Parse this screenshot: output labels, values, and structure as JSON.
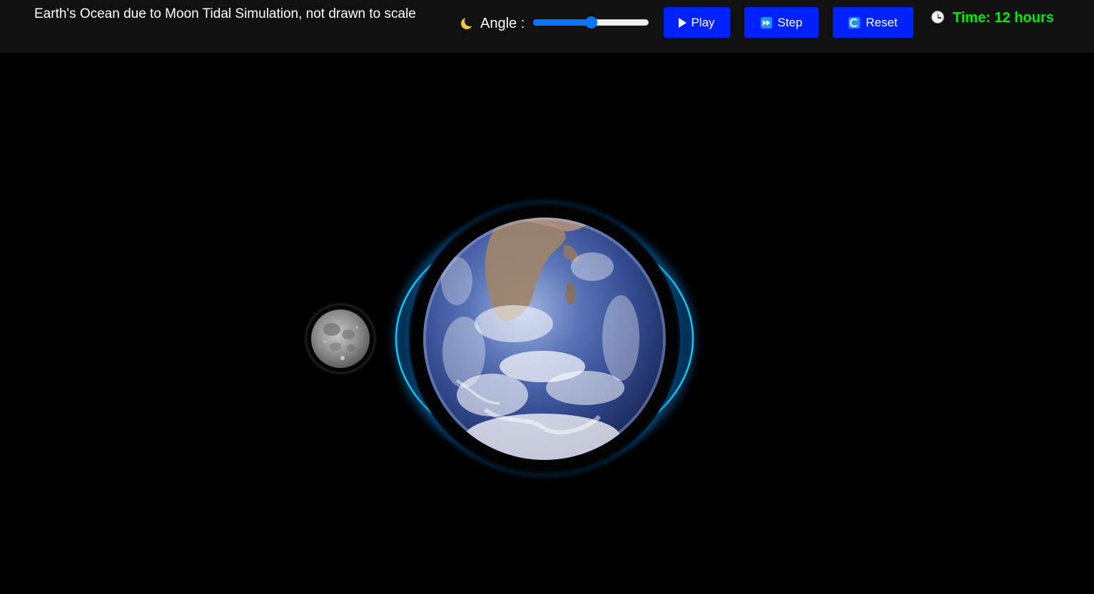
{
  "header": {
    "title": "Earth's Ocean due to Moon Tidal Simulation, not drawn to scale",
    "angle_label": "Angle :",
    "angle_value_fraction": 0.5
  },
  "controls": {
    "play_label": "Play",
    "step_label": "Step",
    "reset_label": "Reset"
  },
  "status": {
    "time_text": "Time: 12 hours"
  },
  "icons": {
    "angle": "crescent-moon-icon",
    "play": "play-triangle-icon",
    "step": "fast-forward-icon",
    "reset": "refresh-icon",
    "time": "clock-icon"
  },
  "colors": {
    "topbar_bg": "#111111",
    "button_bg": "#0022ff",
    "slider_accent": "#0b74ff",
    "time_text": "#00ee00",
    "ocean_glow": "#00cfff"
  }
}
